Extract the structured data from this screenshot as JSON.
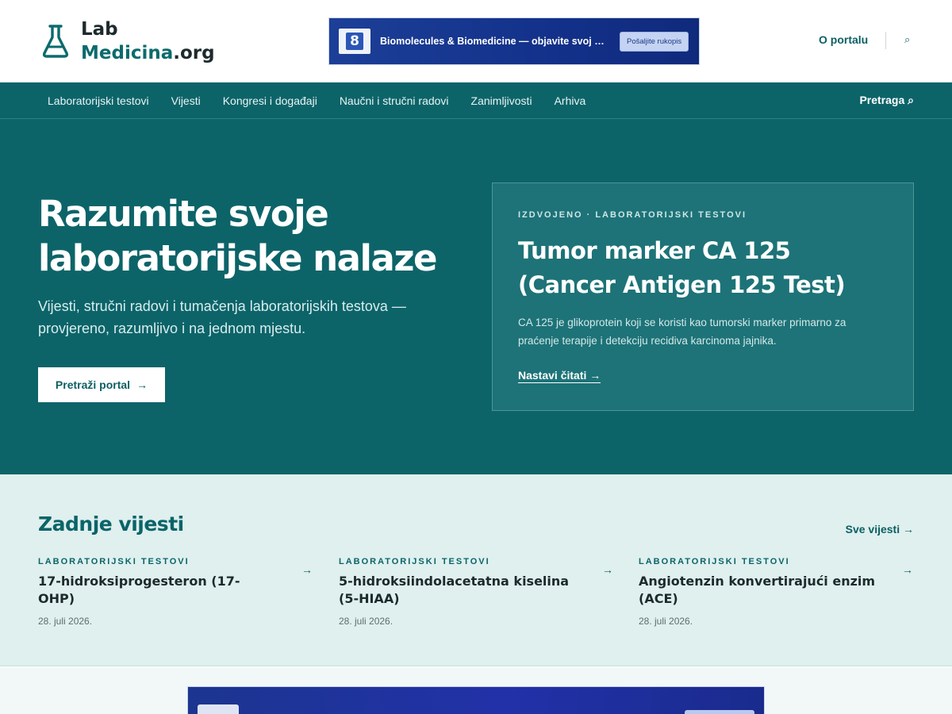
{
  "logo": {
    "line1": "Lab",
    "line2_main": "Medicina",
    "line2_suffix": ".org",
    "icon": "flask-icon"
  },
  "top_banner": {
    "badge": "8",
    "text": "Biomolecules & Biomedicine — objavite svoj …",
    "button": "Pošaljite rukopis"
  },
  "top_links": {
    "about": "O portalu",
    "search_icon": "⌕"
  },
  "nav": {
    "items": [
      "Laboratorijski testovi",
      "Vijesti",
      "Kongresi i događaji",
      "Naučni i stručni radovi",
      "Zanimljivosti",
      "Arhiva"
    ],
    "search": "Pretraga ⌕"
  },
  "hero": {
    "title": "Razumite svoje laboratorijske nalaze",
    "subtitle": "Vijesti, stručni radovi i tumačenja laboratorijskih testova — provjereno, razumljivo i na jednom mjestu.",
    "button": "Pretraži portal",
    "button_arrow": "→"
  },
  "featured": {
    "tag": "IZDVOJENO · LABORATORIJSKI TESTOVI",
    "title": "Tumor marker CA 125 (Cancer Antigen 125 Test)",
    "description": "CA 125 je glikoprotein koji se koristi kao tumorski marker primarno za praćenje terapije i detekciju recidiva karcinoma jajnika.",
    "link": "Nastavi čitati →"
  },
  "latest": {
    "heading": "Zadnje vijesti",
    "all_link": "Sve vijesti →",
    "items": [
      {
        "category": "LABORATORIJSKI TESTOVI",
        "title": "17-hidroksiprogesteron (17-OHP)",
        "date": "28. juli 2026.",
        "arrow": "→"
      },
      {
        "category": "LABORATORIJSKI TESTOVI",
        "title": "5-hidroksiindolacetatna kiselina (5-HIAA)",
        "date": "28. juli 2026.",
        "arrow": "→"
      },
      {
        "category": "LABORATORIJSKI TESTOVI",
        "title": "Angiotenzin konvertirajući enzim (ACE)",
        "date": "28. juli 2026.",
        "arrow": "→"
      }
    ]
  },
  "colors": {
    "primary": "#0c6469",
    "accent_light": "#dff0ee",
    "banner_blue": "#13318a"
  }
}
